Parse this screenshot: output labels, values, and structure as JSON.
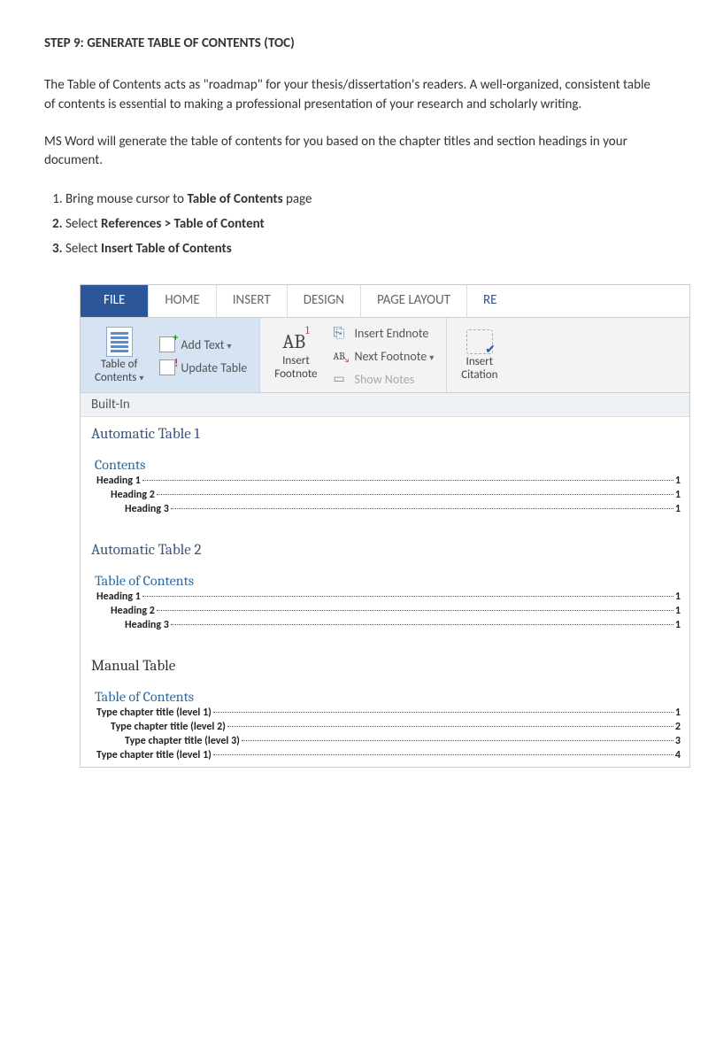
{
  "step_title": "STEP 9: GENERATE TABLE OF CONTENTS (TOC)",
  "para1": "The Table of Contents acts as \"roadmap\" for your thesis/dissertation's readers. A well-organized, consistent table of contents is essential to making a professional presentation of your research and scholarly writing.",
  "para2": "MS Word will generate the table of contents for you based on the chapter titles and section headings in your document.",
  "steps": {
    "s1a": "Bring mouse cursor to ",
    "s1b": "Table of Contents",
    "s1c": " page",
    "s2a": "Select ",
    "s2b": "References > Table of Content",
    "s3a": "Select ",
    "s3b": "Insert Table of Contents"
  },
  "tabs": {
    "file": "FILE",
    "home": "HOME",
    "insert": "INSERT",
    "design": "DESIGN",
    "page_layout": "PAGE LAYOUT",
    "re": "RE"
  },
  "ribbon": {
    "toc": "Table of\nContents",
    "toc1": "Table of",
    "toc2": "Contents",
    "add_text": "Add Text",
    "update_table": "Update Table",
    "insert_footnote1": "Insert",
    "insert_footnote2": "Footnote",
    "insert_endnote": "Insert Endnote",
    "next_footnote": "Next Footnote",
    "show_notes": "Show Notes",
    "insert_citation1": "Insert",
    "insert_citation2": "Citation"
  },
  "gallery": {
    "builtin": "Built-In",
    "auto1": "Automatic Table 1",
    "auto1_title": "Contents",
    "auto2": "Automatic Table 2",
    "auto2_title": "Table of Contents",
    "manual": "Manual Table",
    "manual_title": "Table of Contents",
    "headings": {
      "h1": "Heading 1",
      "h1p": "1",
      "h2": "Heading 2",
      "h2p": "1",
      "h3": "Heading 3",
      "h3p": "1"
    },
    "manual_rows": {
      "r1": "Type chapter title (level 1)",
      "r1p": "1",
      "r2": "Type chapter title (level 2)",
      "r2p": "2",
      "r3": "Type chapter title (level 3)",
      "r3p": "3",
      "r4": "Type chapter title (level 1)",
      "r4p": "4"
    }
  }
}
